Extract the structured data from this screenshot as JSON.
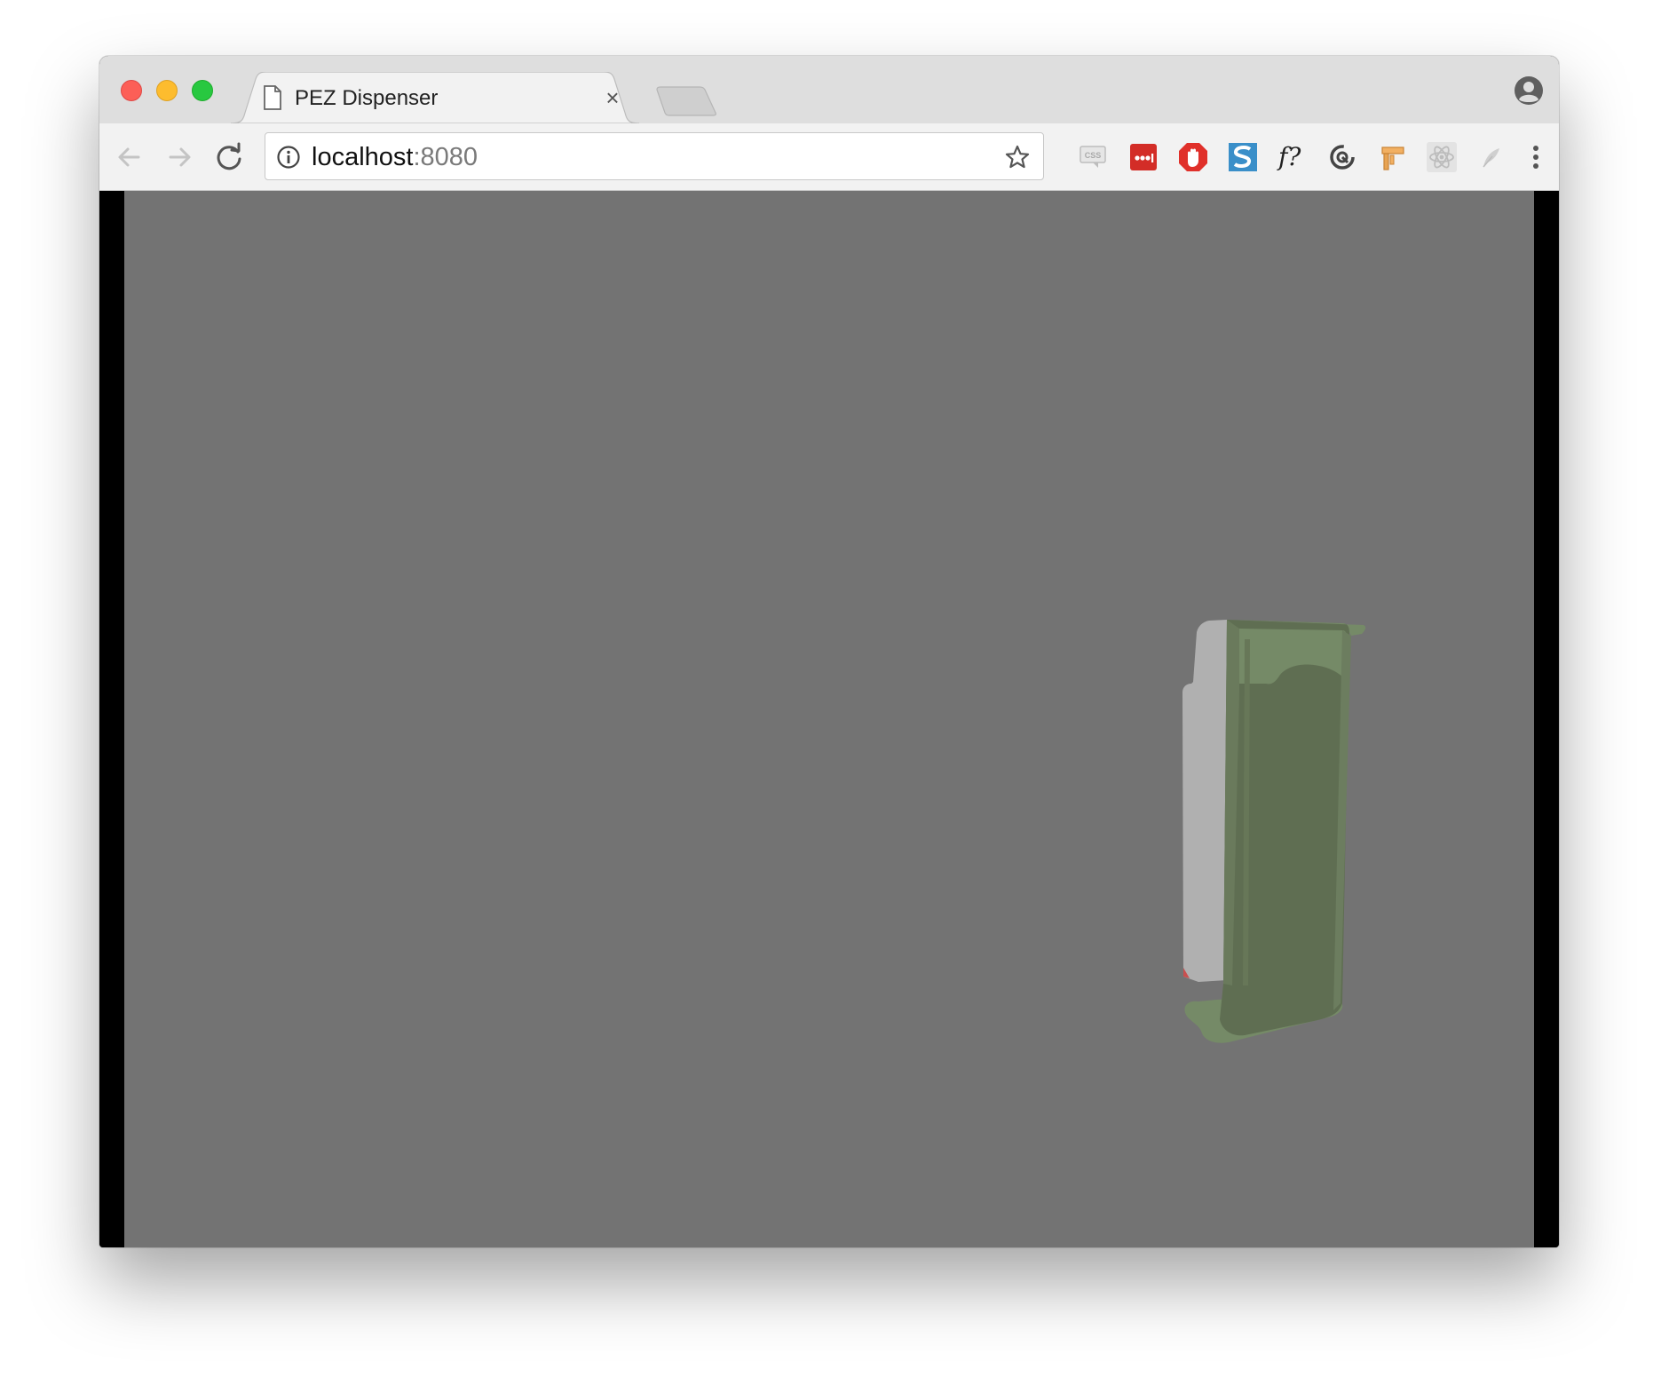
{
  "browser": {
    "tab": {
      "title": "PEZ Dispenser",
      "close_glyph": "×"
    },
    "address_bar": {
      "host": "localhost",
      "port": ":8080"
    },
    "extensions": [
      "css-viewer-icon",
      "lastpass-icon",
      "adblock-icon",
      "s-extension-icon",
      "font-finder-icon",
      "refresh-extension-icon",
      "bookmark-flag-icon",
      "react-devtools-icon",
      "feather-icon"
    ]
  },
  "page": {
    "scene": "pez-dispenser-3d",
    "background_color": "#737373",
    "model_colors": {
      "body": "#5f6e52",
      "body_light": "#758a67",
      "head": "#b0b0b0"
    }
  }
}
